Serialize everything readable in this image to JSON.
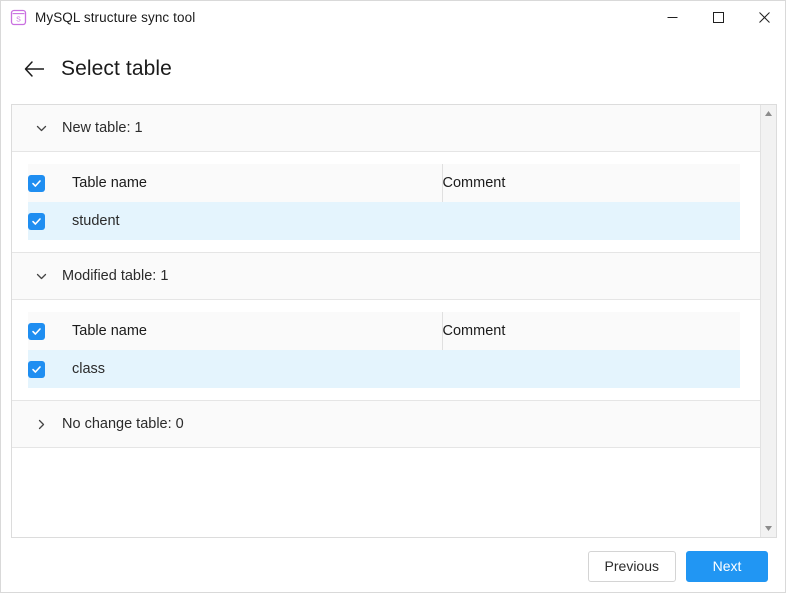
{
  "window": {
    "title": "MySQL structure sync tool",
    "app_icon": "mysql-sync-icon",
    "controls": {
      "minimize": "minimize-icon",
      "maximize": "maximize-icon",
      "close": "close-icon"
    }
  },
  "header": {
    "back_icon": "back-arrow-icon",
    "title": "Select table"
  },
  "sections": [
    {
      "id": "new-table",
      "label": "New table: 1",
      "expanded": true,
      "chevron": "chevron-down-icon",
      "columns": {
        "select_all": true,
        "name": "Table name",
        "comment": "Comment"
      },
      "rows": [
        {
          "checked": true,
          "name": "student",
          "comment": ""
        }
      ]
    },
    {
      "id": "modified-table",
      "label": "Modified table: 1",
      "expanded": true,
      "chevron": "chevron-down-icon",
      "columns": {
        "select_all": true,
        "name": "Table name",
        "comment": "Comment"
      },
      "rows": [
        {
          "checked": true,
          "name": "class",
          "comment": ""
        }
      ]
    },
    {
      "id": "no-change-table",
      "label": "No change table: 0",
      "expanded": false,
      "chevron": "chevron-right-icon",
      "columns": null,
      "rows": []
    }
  ],
  "scrollbar": {
    "up_icon": "scroll-up-arrow-icon",
    "down_icon": "scroll-down-arrow-icon"
  },
  "footer": {
    "previous_label": "Previous",
    "next_label": "Next"
  },
  "colors": {
    "accent": "#2196f3",
    "checkbox": "#1f8ef1",
    "row_selected": "#e4f4fd",
    "header_bg": "#fafafa",
    "app_icon": "#c96fe0"
  }
}
